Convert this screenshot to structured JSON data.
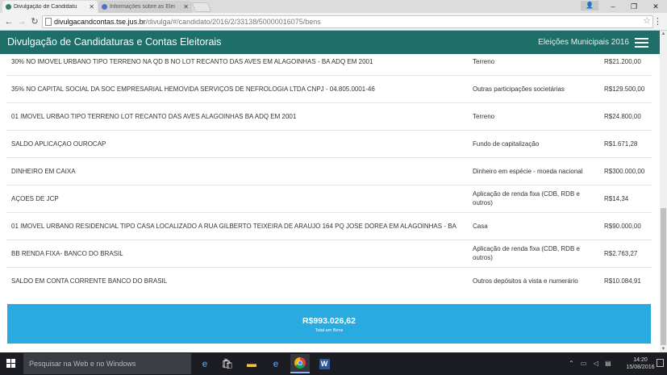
{
  "browser": {
    "tabs": [
      {
        "title": "Divulgação de Candidatu",
        "active": true
      },
      {
        "title": "Informações sobre as Elei",
        "active": false
      }
    ],
    "url_host": "divulgacandcontas.tse.jus.br",
    "url_path": "/divulga/#/candidato/2016/2/33138/50000016075/bens",
    "window_controls": [
      "–",
      "❐",
      "✕"
    ]
  },
  "header": {
    "title": "Divulgação de Candidaturas e Contas Eleitorais",
    "election": "Eleições Municipais 2016"
  },
  "bens": [
    {
      "descricao": "30% NO IMOVEL URBANO TIPO TERRENO NA QD B NO LOT RECANTO DAS AVES EM ALAGOINHAS - BA ADQ EM 2001",
      "tipo": "Terreno",
      "valor": "R$21.200,00"
    },
    {
      "descricao": "35% NO CAPITAL SOCIAL DA SOC EMPRESARIAL HEMOVIDA SERVIÇOS DE NEFROLOGIA LTDA CNPJ - 04.805.0001-46",
      "tipo": "Outras participações societárias",
      "valor": "R$129.500,00"
    },
    {
      "descricao": "01 IMOVEL URBAO TIPO TERRENO LOT RECANTO DAS AVES ALAGOINHAS BA ADQ EM 2001",
      "tipo": "Terreno",
      "valor": "R$24.800,00"
    },
    {
      "descricao": "SALDO APLICAÇAO OUROCAP",
      "tipo": "Fundo de capitalização",
      "valor": "R$1.671,28"
    },
    {
      "descricao": "DINHEIRO EM CAIXA",
      "tipo": "Dinheiro em espécie - moeda nacional",
      "valor": "R$300.000,00"
    },
    {
      "descricao": "AÇOES DE JCP",
      "tipo": "Aplicação de renda fixa (CDB, RDB e outros)",
      "valor": "R$14,34"
    },
    {
      "descricao": "01 IMOVEL URBANO RESIDENCIAL TIPO CASA LOCALIZADO A RUA GILBERTO TEIXEIRA DE ARAUJO 164 PQ JOSE DOREA EM ALAGOINHAS - BA",
      "tipo": "Casa",
      "valor": "R$90.000,00"
    },
    {
      "descricao": "BB RENDA FIXA- BANCO DO BRASIL",
      "tipo": "Aplicação de renda fixa (CDB, RDB e outros)",
      "valor": "R$2.763,27"
    },
    {
      "descricao": "SALDO EM CONTA CORRENTE BANCO DO BRASIL",
      "tipo": "Outros depósitos à vista e numerário",
      "valor": "R$10.084,91"
    }
  ],
  "total": {
    "valor": "R$993.026,62",
    "label": "Total em Bens"
  },
  "taskbar": {
    "search_placeholder": "Pesquisar na Web e no Windows",
    "time": "14:20",
    "date": "15/08/2016"
  }
}
